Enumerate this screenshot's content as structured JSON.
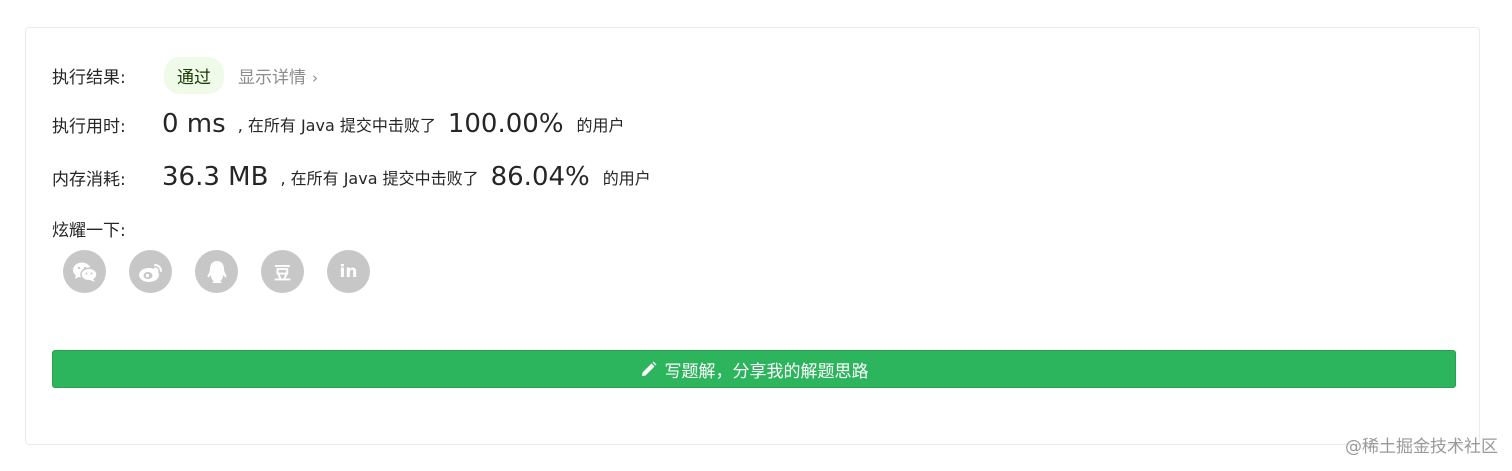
{
  "result": {
    "label": "执行结果:",
    "status": "通过",
    "detail_link": "显示详情",
    "detail_chevron": "›"
  },
  "runtime": {
    "label": "执行用时:",
    "value": "0 ms",
    "beat_prefix": ", 在所有 Java 提交中击败了",
    "percent": "100.00%",
    "suffix": "的用户"
  },
  "memory": {
    "label": "内存消耗:",
    "value": "36.3 MB",
    "beat_prefix": ", 在所有 Java 提交中击败了",
    "percent": "86.04%",
    "suffix": "的用户"
  },
  "share": {
    "label": "炫耀一下:",
    "icons": [
      "wechat-icon",
      "weibo-icon",
      "qq-icon",
      "douban-icon",
      "linkedin-icon"
    ],
    "douban_glyph": "豆",
    "linkedin_glyph": "in",
    "icon_color": "#c7c7c7"
  },
  "write_solution": {
    "label": "写题解，分享我的解题思路",
    "icon": "pencil-icon",
    "color": "#2db55d"
  },
  "watermark": "@稀土掘金技术社区"
}
